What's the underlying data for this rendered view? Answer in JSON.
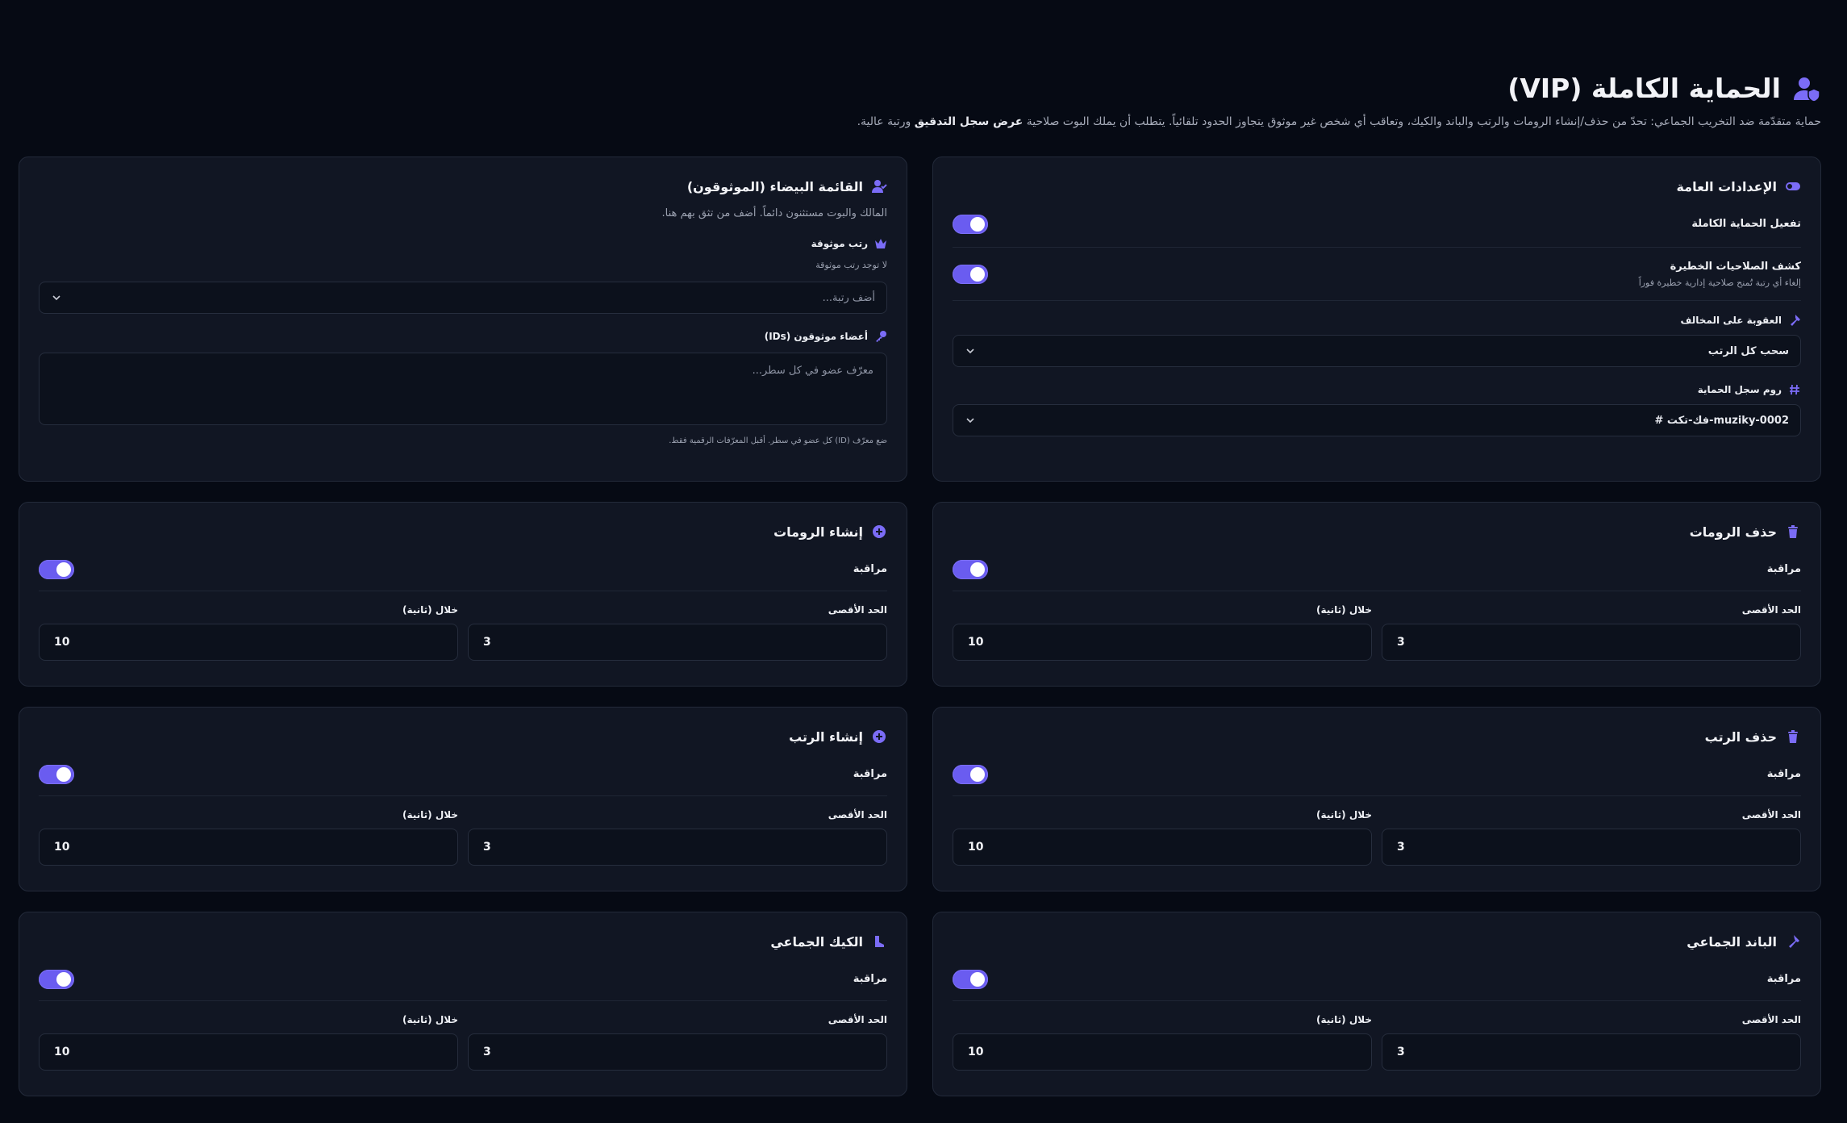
{
  "header": {
    "title": "الحماية الكاملة (VIP)",
    "description_pre": "حماية متقدّمة ضد التخريب الجماعي: تحدّ من حذف/إنشاء الرومات والرتب والباند والكيك، وتعاقب أي شخص غير موثوق يتجاوز الحدود تلقائياً. يتطلب أن يملك البوت صلاحية",
    "description_bold": "عرض سجل التدقيق",
    "description_post": "ورتبة عالية."
  },
  "general": {
    "title": "الإعدادات العامة",
    "enable_label": "تفعيل الحماية الكاملة",
    "danger_label": "كشف الصلاحيات الخطيرة",
    "danger_sub": "إلغاء أي رتبة تُمنح صلاحية إدارية خطيرة فوراً",
    "punish_label": "العقوبة على المخالف",
    "punish_value": "سحب كل الرتب",
    "log_label": "روم سجل الحماية",
    "log_value": "# فك-تكت-muziky-0002"
  },
  "whitelist": {
    "title": "القائمة البيضاء (الموثوقون)",
    "subtitle": "المالك والبوت مستثنون دائماً. أضف من تثق بهم هنا.",
    "roles_label": "رتب موثوقة",
    "roles_empty": "لا توجد رتب موثوقة",
    "roles_placeholder": "أضف رتبة...",
    "members_label": "أعضاء موثوقون (IDs)",
    "members_placeholder": "معرّف عضو في كل سطر...",
    "members_hint": "ضع معرّف (ID) كل عضو في سطر. أقبل المعرّفات الرقمية فقط."
  },
  "labels": {
    "monitor": "مراقبة",
    "max": "الحد الأقصى",
    "within": "خلال (ثانية)"
  },
  "modules": {
    "channel_delete": {
      "title": "حذف الرومات",
      "max": "3",
      "within": "10"
    },
    "channel_create": {
      "title": "إنشاء الرومات",
      "max": "3",
      "within": "10"
    },
    "role_delete": {
      "title": "حذف الرتب",
      "max": "3",
      "within": "10"
    },
    "role_create": {
      "title": "إنشاء الرتب",
      "max": "3",
      "within": "10"
    },
    "mass_ban": {
      "title": "الباند الجماعي",
      "max": "3",
      "within": "10"
    },
    "mass_kick": {
      "title": "الكيك الجماعي",
      "max": "3",
      "within": "10"
    }
  },
  "colors": {
    "accent": "#6a5cf0",
    "bg": "#060a14",
    "card": "#111623"
  },
  "icons": {
    "title": "user-shield-icon",
    "general": "toggle-icon",
    "whitelist": "user-check-icon",
    "channel_delete": "trash-icon",
    "channel_create": "plus-circle-icon",
    "role_delete": "trash-icon",
    "role_create": "plus-circle-icon",
    "mass_ban": "hammer-icon",
    "mass_kick": "boot-icon"
  }
}
